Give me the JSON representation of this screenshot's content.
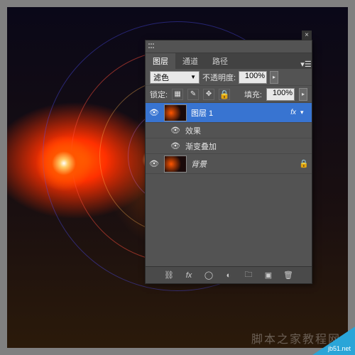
{
  "panel": {
    "tabs": {
      "layers": "图层",
      "channels": "通道",
      "paths": "路径"
    },
    "blend_mode": "滤色",
    "opacity_label": "不透明度:",
    "opacity_value": "100%",
    "lock_label": "锁定:",
    "fill_label": "填充:",
    "fill_value": "100%",
    "layers": [
      {
        "name": "图层 1",
        "selected": true,
        "has_fx": true
      },
      {
        "name": "效果",
        "sub": true
      },
      {
        "name": "渐变叠加",
        "sub": true,
        "has_eye": true
      },
      {
        "name": "背景",
        "locked": true
      }
    ],
    "fx_text": "fx"
  },
  "watermark": "脚本之家教程网",
  "corner_text": "jb51.net"
}
